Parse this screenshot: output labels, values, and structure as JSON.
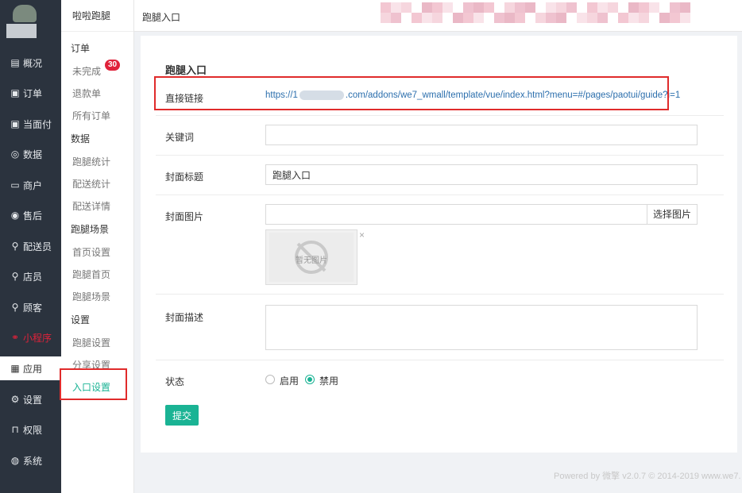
{
  "sidebar": {
    "items": [
      {
        "icon": "overview-icon",
        "glyph": "▤",
        "label": "概况"
      },
      {
        "icon": "order-icon",
        "glyph": "▣",
        "label": "订单"
      },
      {
        "icon": "pay-icon",
        "glyph": "▣",
        "label": "当面付"
      },
      {
        "icon": "data-icon",
        "glyph": "◎",
        "label": "数据"
      },
      {
        "icon": "merchant-icon",
        "glyph": "▭",
        "label": "商户"
      },
      {
        "icon": "aftersale-icon",
        "glyph": "◉",
        "label": "售后"
      },
      {
        "icon": "courier-icon",
        "glyph": "⚲",
        "label": "配送员"
      },
      {
        "icon": "clerk-icon",
        "glyph": "⚲",
        "label": "店员"
      },
      {
        "icon": "customer-icon",
        "glyph": "⚲",
        "label": "顾客"
      },
      {
        "icon": "miniprogram-icon",
        "glyph": "⚭",
        "label": "小程序"
      },
      {
        "icon": "apps-icon",
        "glyph": "▦",
        "label": "应用"
      },
      {
        "icon": "gear-icon",
        "glyph": "⚙",
        "label": "设置"
      },
      {
        "icon": "lock-icon",
        "glyph": "⊓",
        "label": "权限"
      },
      {
        "icon": "system-icon",
        "glyph": "◍",
        "label": "系统"
      }
    ]
  },
  "submenu": {
    "title": "啦啦跑腿",
    "groups": [
      {
        "label": "订单"
      },
      {
        "label": "数据"
      },
      {
        "label": "跑腿场景"
      },
      {
        "label": "设置"
      }
    ],
    "links": [
      {
        "label": "未完成",
        "badge": "30"
      },
      {
        "label": "退款单"
      },
      {
        "label": "所有订单"
      },
      {
        "label": "跑腿统计"
      },
      {
        "label": "配送统计"
      },
      {
        "label": "配送详情"
      },
      {
        "label": "首页设置"
      },
      {
        "label": "跑腿首页"
      },
      {
        "label": "跑腿场景"
      },
      {
        "label": "跑腿设置"
      },
      {
        "label": "分享设置"
      },
      {
        "label": "入口设置"
      }
    ]
  },
  "topbar": {
    "breadcrumb": "跑腿入口"
  },
  "form": {
    "title": "跑腿入口",
    "link_label": "直接链接",
    "link_prefix": "https://1",
    "link_suffix": ".com/addons/we7_wmall/template/vue/index.html?menu=#/pages/paotui/guide?i=1",
    "keyword_label": "关键词",
    "keyword_value": "",
    "cover_title_label": "封面标题",
    "cover_title_value": "跑腿入口",
    "cover_image_label": "封面图片",
    "cover_image_value": "",
    "select_image_button": "选择图片",
    "no_image_text": "暂无图片",
    "remove_mark": "×",
    "cover_desc_label": "封面描述",
    "status_label": "状态",
    "status_options": [
      "启用",
      "禁用"
    ],
    "status_selected": "禁用",
    "submit_label": "提交"
  },
  "footer": {
    "text": "Powered by 微擎 v2.0.7 © 2014-2019 www.we7."
  },
  "colors": {
    "accent": "#1ab394",
    "badge": "#e0223a",
    "highlight": "#e02b2b",
    "sidebar_bg": "#2b333e"
  }
}
